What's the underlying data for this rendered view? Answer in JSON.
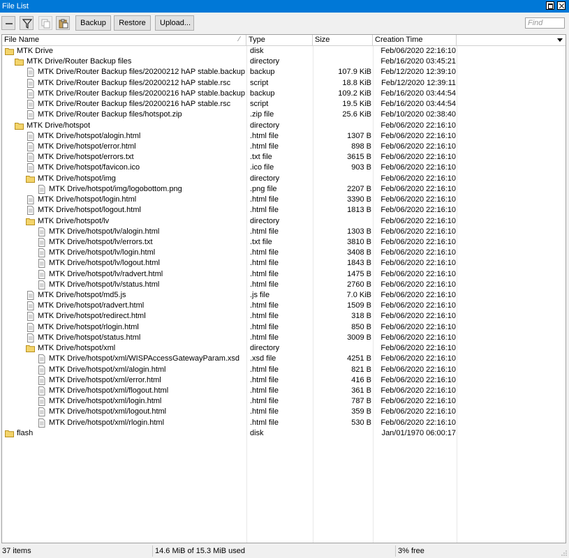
{
  "window": {
    "title": "File List"
  },
  "toolbar": {
    "backup_label": "Backup",
    "restore_label": "Restore",
    "upload_label": "Upload...",
    "find_placeholder": "Find"
  },
  "columns": [
    "File Name",
    "Type",
    "Size",
    "Creation Time"
  ],
  "rows": [
    {
      "name": "MTK Drive",
      "type": "disk",
      "size": "",
      "created": "Feb/06/2020 22:16:10",
      "kind": "folder",
      "level": 0
    },
    {
      "name": "MTK Drive/Router Backup files",
      "type": "directory",
      "size": "",
      "created": "Feb/16/2020 03:45:21",
      "kind": "folder",
      "level": 1
    },
    {
      "name": "MTK Drive/Router Backup files/20200212 hAP stable.backup",
      "type": "backup",
      "size": "107.9 KiB",
      "created": "Feb/12/2020 12:39:10",
      "kind": "file",
      "level": 2
    },
    {
      "name": "MTK Drive/Router Backup files/20200212 hAP stable.rsc",
      "type": "script",
      "size": "18.8 KiB",
      "created": "Feb/12/2020 12:39:11",
      "kind": "file",
      "level": 2
    },
    {
      "name": "MTK Drive/Router Backup files/20200216 hAP stable.backup",
      "type": "backup",
      "size": "109.2 KiB",
      "created": "Feb/16/2020 03:44:54",
      "kind": "file",
      "level": 2
    },
    {
      "name": "MTK Drive/Router Backup files/20200216 hAP stable.rsc",
      "type": "script",
      "size": "19.5 KiB",
      "created": "Feb/16/2020 03:44:54",
      "kind": "file",
      "level": 2
    },
    {
      "name": "MTK Drive/Router Backup files/hotspot.zip",
      "type": ".zip file",
      "size": "25.6 KiB",
      "created": "Feb/10/2020 02:38:40",
      "kind": "file",
      "level": 2
    },
    {
      "name": "MTK Drive/hotspot",
      "type": "directory",
      "size": "",
      "created": "Feb/06/2020 22:16:10",
      "kind": "folder",
      "level": 1
    },
    {
      "name": "MTK Drive/hotspot/alogin.html",
      "type": ".html file",
      "size": "1307 B",
      "created": "Feb/06/2020 22:16:10",
      "kind": "file",
      "level": 2
    },
    {
      "name": "MTK Drive/hotspot/error.html",
      "type": ".html file",
      "size": "898 B",
      "created": "Feb/06/2020 22:16:10",
      "kind": "file",
      "level": 2
    },
    {
      "name": "MTK Drive/hotspot/errors.txt",
      "type": ".txt file",
      "size": "3615 B",
      "created": "Feb/06/2020 22:16:10",
      "kind": "file",
      "level": 2
    },
    {
      "name": "MTK Drive/hotspot/favicon.ico",
      "type": ".ico file",
      "size": "903 B",
      "created": "Feb/06/2020 22:16:10",
      "kind": "file",
      "level": 2
    },
    {
      "name": "MTK Drive/hotspot/img",
      "type": "directory",
      "size": "",
      "created": "Feb/06/2020 22:16:10",
      "kind": "folder",
      "level": 2
    },
    {
      "name": "MTK Drive/hotspot/img/logobottom.png",
      "type": ".png file",
      "size": "2207 B",
      "created": "Feb/06/2020 22:16:10",
      "kind": "file",
      "level": 3
    },
    {
      "name": "MTK Drive/hotspot/login.html",
      "type": ".html file",
      "size": "3390 B",
      "created": "Feb/06/2020 22:16:10",
      "kind": "file",
      "level": 2
    },
    {
      "name": "MTK Drive/hotspot/logout.html",
      "type": ".html file",
      "size": "1813 B",
      "created": "Feb/06/2020 22:16:10",
      "kind": "file",
      "level": 2
    },
    {
      "name": "MTK Drive/hotspot/lv",
      "type": "directory",
      "size": "",
      "created": "Feb/06/2020 22:16:10",
      "kind": "folder",
      "level": 2
    },
    {
      "name": "MTK Drive/hotspot/lv/alogin.html",
      "type": ".html file",
      "size": "1303 B",
      "created": "Feb/06/2020 22:16:10",
      "kind": "file",
      "level": 3
    },
    {
      "name": "MTK Drive/hotspot/lv/errors.txt",
      "type": ".txt file",
      "size": "3810 B",
      "created": "Feb/06/2020 22:16:10",
      "kind": "file",
      "level": 3
    },
    {
      "name": "MTK Drive/hotspot/lv/login.html",
      "type": ".html file",
      "size": "3408 B",
      "created": "Feb/06/2020 22:16:10",
      "kind": "file",
      "level": 3
    },
    {
      "name": "MTK Drive/hotspot/lv/logout.html",
      "type": ".html file",
      "size": "1843 B",
      "created": "Feb/06/2020 22:16:10",
      "kind": "file",
      "level": 3
    },
    {
      "name": "MTK Drive/hotspot/lv/radvert.html",
      "type": ".html file",
      "size": "1475 B",
      "created": "Feb/06/2020 22:16:10",
      "kind": "file",
      "level": 3
    },
    {
      "name": "MTK Drive/hotspot/lv/status.html",
      "type": ".html file",
      "size": "2760 B",
      "created": "Feb/06/2020 22:16:10",
      "kind": "file",
      "level": 3
    },
    {
      "name": "MTK Drive/hotspot/md5.js",
      "type": ".js file",
      "size": "7.0 KiB",
      "created": "Feb/06/2020 22:16:10",
      "kind": "file",
      "level": 2
    },
    {
      "name": "MTK Drive/hotspot/radvert.html",
      "type": ".html file",
      "size": "1509 B",
      "created": "Feb/06/2020 22:16:10",
      "kind": "file",
      "level": 2
    },
    {
      "name": "MTK Drive/hotspot/redirect.html",
      "type": ".html file",
      "size": "318 B",
      "created": "Feb/06/2020 22:16:10",
      "kind": "file",
      "level": 2
    },
    {
      "name": "MTK Drive/hotspot/rlogin.html",
      "type": ".html file",
      "size": "850 B",
      "created": "Feb/06/2020 22:16:10",
      "kind": "file",
      "level": 2
    },
    {
      "name": "MTK Drive/hotspot/status.html",
      "type": ".html file",
      "size": "3009 B",
      "created": "Feb/06/2020 22:16:10",
      "kind": "file",
      "level": 2
    },
    {
      "name": "MTK Drive/hotspot/xml",
      "type": "directory",
      "size": "",
      "created": "Feb/06/2020 22:16:10",
      "kind": "folder",
      "level": 2
    },
    {
      "name": "MTK Drive/hotspot/xml/WISPAccessGatewayParam.xsd",
      "type": ".xsd file",
      "size": "4251 B",
      "created": "Feb/06/2020 22:16:10",
      "kind": "file",
      "level": 3
    },
    {
      "name": "MTK Drive/hotspot/xml/alogin.html",
      "type": ".html file",
      "size": "821 B",
      "created": "Feb/06/2020 22:16:10",
      "kind": "file",
      "level": 3
    },
    {
      "name": "MTK Drive/hotspot/xml/error.html",
      "type": ".html file",
      "size": "416 B",
      "created": "Feb/06/2020 22:16:10",
      "kind": "file",
      "level": 3
    },
    {
      "name": "MTK Drive/hotspot/xml/flogout.html",
      "type": ".html file",
      "size": "361 B",
      "created": "Feb/06/2020 22:16:10",
      "kind": "file",
      "level": 3
    },
    {
      "name": "MTK Drive/hotspot/xml/login.html",
      "type": ".html file",
      "size": "787 B",
      "created": "Feb/06/2020 22:16:10",
      "kind": "file",
      "level": 3
    },
    {
      "name": "MTK Drive/hotspot/xml/logout.html",
      "type": ".html file",
      "size": "359 B",
      "created": "Feb/06/2020 22:16:10",
      "kind": "file",
      "level": 3
    },
    {
      "name": "MTK Drive/hotspot/xml/rlogin.html",
      "type": ".html file",
      "size": "530 B",
      "created": "Feb/06/2020 22:16:10",
      "kind": "file",
      "level": 3
    },
    {
      "name": "flash",
      "type": "disk",
      "size": "",
      "created": "Jan/01/1970 06:00:17",
      "kind": "folder",
      "level": 0
    }
  ],
  "status": {
    "items": "37 items",
    "usage": "14.6 MiB of 15.3 MiB used",
    "free": "3% free"
  },
  "colors": {
    "titlebar": "#0078d7",
    "folder": "#e8c048"
  }
}
